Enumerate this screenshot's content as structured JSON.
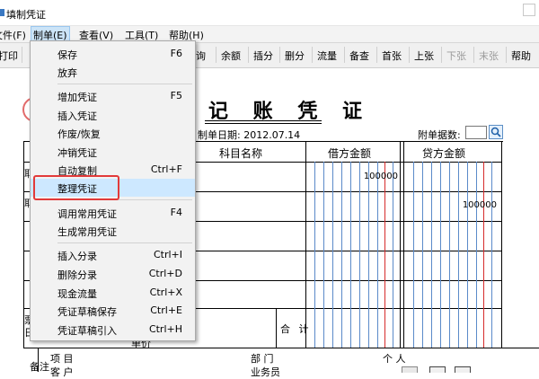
{
  "window": {
    "title": "填制凭证"
  },
  "menubar": {
    "items": [
      {
        "label": "文件(F)"
      },
      {
        "label": "制单(E)"
      },
      {
        "label": "查看(V)"
      },
      {
        "label": "工具(T)"
      },
      {
        "label": "帮助(H)"
      }
    ]
  },
  "toolbar": {
    "items": [
      {
        "label": "打印"
      },
      {
        "label": "询"
      },
      {
        "label": "余额"
      },
      {
        "label": "插分"
      },
      {
        "label": "删分"
      },
      {
        "label": "流量"
      },
      {
        "label": "备查"
      },
      {
        "label": "首张"
      },
      {
        "label": "上张"
      },
      {
        "label": "下张",
        "disabled": true
      },
      {
        "label": "末张",
        "disabled": true
      },
      {
        "label": "帮助"
      }
    ]
  },
  "voucher": {
    "title": "记 账 凭 证",
    "date_label": "制单日期: 2012.07.14",
    "attach_label": "附单据数:",
    "header_subject": "科目名称",
    "header_debit": "借方金额",
    "header_credit": "贷方金额",
    "debit_amount_row1": "100000",
    "credit_amount_row2": "100000",
    "total_label": "合 计",
    "left_cut_a": "耶",
    "left_cut_b": "耶",
    "left_cut_c": "票",
    "left_cut_d": "日",
    "bottom_cut": "单价"
  },
  "footer": {
    "note_label": "备注",
    "item_label": "项  目",
    "customer_label": "客  户",
    "department_label": "部  门",
    "salesperson_label": "业务员",
    "person_label": "个  人"
  },
  "dropdown": {
    "items": [
      {
        "label": "保存",
        "shortcut": "F6"
      },
      {
        "label": "放弃",
        "shortcut": ""
      },
      {
        "label": "增加凭证",
        "shortcut": "F5"
      },
      {
        "label": "插入凭证",
        "shortcut": ""
      },
      {
        "label": "作废/恢复",
        "shortcut": ""
      },
      {
        "label": "冲销凭证",
        "shortcut": ""
      },
      {
        "label": "自动复制",
        "shortcut": "Ctrl+F"
      },
      {
        "label": "整理凭证",
        "shortcut": "",
        "highlighted": true
      },
      {
        "label": "调用常用凭证",
        "shortcut": "F4"
      },
      {
        "label": "生成常用凭证",
        "shortcut": ""
      },
      {
        "label": "插入分录",
        "shortcut": "Ctrl+I"
      },
      {
        "label": "删除分录",
        "shortcut": "Ctrl+D"
      },
      {
        "label": "现金流量",
        "shortcut": "Ctrl+X"
      },
      {
        "label": "凭证草稿保存",
        "shortcut": "Ctrl+E"
      },
      {
        "label": "凭证草稿引入",
        "shortcut": "Ctrl+H"
      }
    ]
  }
}
